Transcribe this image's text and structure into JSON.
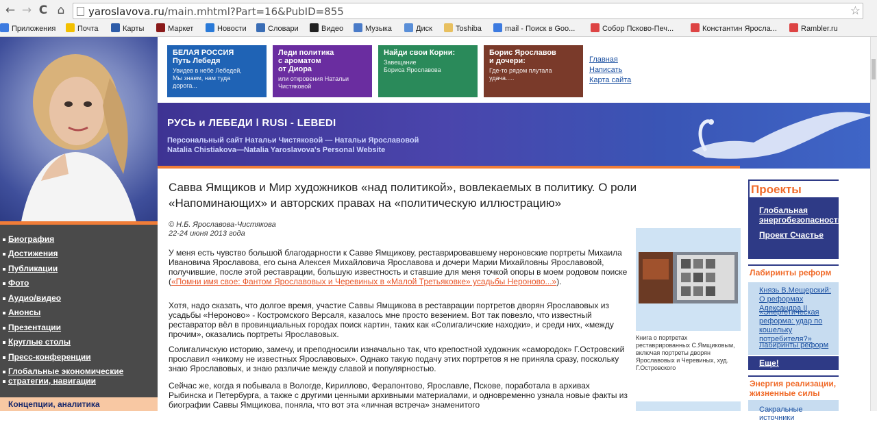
{
  "browser": {
    "url_domain": "yaroslavova.ru",
    "url_path": "/main.mhtml?Part=16&PubID=855",
    "back": "←",
    "forward": "→",
    "reload": "C",
    "home": "⌂",
    "star": "☆"
  },
  "bookmarks": [
    {
      "label": "Приложения",
      "color": "#3d7be0"
    },
    {
      "label": "Почта",
      "color": "#f3c000"
    },
    {
      "label": "Карты",
      "color": "#2e5ca8"
    },
    {
      "label": "Маркет",
      "color": "#8a1a1a"
    },
    {
      "label": "Новости",
      "color": "#2a7ad8"
    },
    {
      "label": "Словари",
      "color": "#3a6db5"
    },
    {
      "label": "Видео",
      "color": "#222222"
    },
    {
      "label": "Музыка",
      "color": "#4a7bc8"
    },
    {
      "label": "Диск",
      "color": "#5a8fd8"
    },
    {
      "label": "Toshiba",
      "color": "#e8c060"
    },
    {
      "label": "mail - Поиск в Goo...",
      "color": "#3d7be0"
    },
    {
      "label": "Собор Псково-Печ...",
      "color": "#d44"
    },
    {
      "label": "Константин Яросла...",
      "color": "#d44"
    },
    {
      "label": "Rambler.ru",
      "color": "#d44"
    }
  ],
  "header_boxes": [
    {
      "title": "БЕЛАЯ  РОССИЯ\nПуть Лебедя",
      "sub": "Увидев в небе Лебедей,\nМы знаем, нам туда\nдорога...",
      "color": "#1f63b5"
    },
    {
      "title": "Леди  политика\nс  ароматом\nот Диора",
      "sub": "или  откровения  Натальи\nЧистяковой",
      "color": "#6a2da0"
    },
    {
      "title": "Найди свои Корни:",
      "sub": "Завещание\nБориса Ярославова",
      "color": "#2a8a5a"
    },
    {
      "title": "Борис Ярославов\nи дочери:",
      "sub": "Где-то рядом плутала\nудача.....",
      "color": "#7a3a2a"
    }
  ],
  "header_links": [
    "Главная",
    "Написать",
    "Карта сайта"
  ],
  "banner": {
    "title": "РУСЬ и ЛЕБЕДИ ǀ RUSI - LEBEDI",
    "sub1": "Персональный сайт Натальи Чистяковой — Натальи Ярославовой",
    "sub2": "Natalia Chistiakova—Natalia Yaroslavova's  Personal Website"
  },
  "left_menu": [
    "Биография",
    "Достижения",
    "Публикации",
    "Фото",
    "Аудио/видео",
    "Анонсы",
    "Презентации",
    "Круглые столы",
    "Пресс-конференции",
    "Глобальные экономические",
    "стратегии, навигации"
  ],
  "left_bottom": "Концепции, аналитика",
  "article": {
    "title": "Савва Ямщиков и Мир художников «над политикой», вовлекаемых в политику. О роли «Напоминающих» и авторских правах на «политическую иллюстрацию»",
    "author": "© Н.Б. Ярославова-Чистякова",
    "date": "22-24 июня 2013 года",
    "p1_a": "У меня есть чувство большой благодарности к Савве Ямщикову, реставрировавшему нероновские портреты Михаила Ивановича Ярославова, его сына Алексея Михайловича Ярославова и дочери Марии Михайловны Ярославовой, получившие, после этой реставрации, большую известность и ставшие для меня точкой опоры в моем родовом поиске (",
    "p1_link": "«Помни имя свое: Фантом Ярославовых и Черевиных в «Малой Третьяковке» усадьбы Нероново...»",
    "p1_b": ").",
    "p2": "Хотя, надо сказать, что долгое время, участие Саввы Ямщикова в реставрации портретов дворян Ярославовых из усадьбы «Нероново» - Костромского Версаля, казалось мне просто везением. Вот так повезло, что известный реставратор вёл в провинциальных городах поиск картин, таких как «Солигаличские находки», и среди них, «между прочим», оказались портреты Ярославовых.",
    "p3": "Солигаличскую историю, замечу, и преподносили изначально так, что крепостной художник «самородок» Г.Островский прославил «никому не известных Ярославовых». Однако такую подачу этих портретов я не приняла сразу, поскольку знаю Ярославовых, и знаю различие между славой и популярностью.",
    "p4": "Сейчас же, когда я побывала в Вологде, Кириллово, Ферапонтово, Ярославле, Пскове, поработала в архивах Рыбинска и Петербурга, а также с другими ценными архивными материалами, и одновременно узнала новые факты из биографии Саввы Ямщикова, поняла, что вот эта «личная встреча» знаменитого",
    "fig_caption": "Книга о портретах реставрированных С.Ямщиковым, включая портреты дворян Ярославовых и Черевиных, худ. Г.Островского"
  },
  "right": {
    "projects_title": "Проекты",
    "projects": [
      "Глобальная энергобезопасность",
      "Проект Счастье"
    ],
    "lab_title": "Лабиринты реформ",
    "lab_items": [
      "Князь В.Мещерский: О реформах Александра II",
      "«Энергетическая реформа: удар по кошельку потребителя?»",
      "Лабиринты реформ"
    ],
    "more": "Еще!",
    "energy_title": "Энергия реализации, жизненные силы",
    "energy_item": "Сакральные источники"
  }
}
